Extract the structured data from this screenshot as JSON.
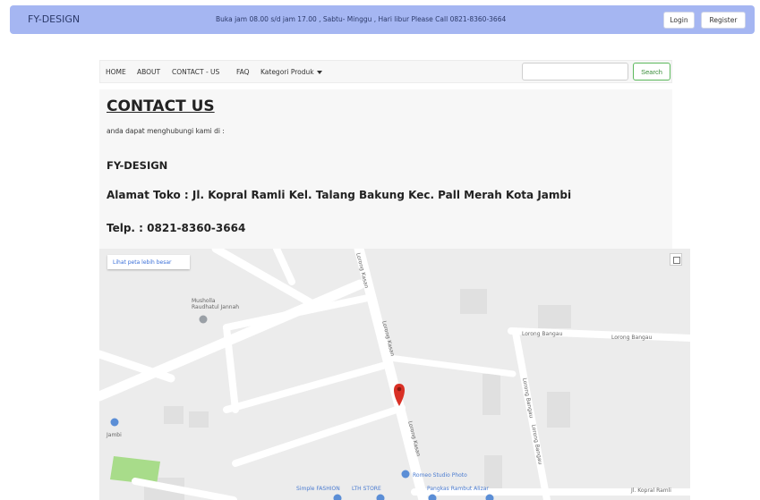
{
  "topbar": {
    "brand": "FY-DESIGN",
    "announcement": "Buka jam 08.00 s/d jam 17.00 , Sabtu- Minggu , Hari libur Please Call 0821-8360-3664",
    "login_label": "Login",
    "register_label": "Register"
  },
  "nav": {
    "items": [
      {
        "label": "HOME"
      },
      {
        "label": "ABOUT"
      },
      {
        "label": "CONTACT - US"
      },
      {
        "label": "FAQ"
      },
      {
        "label": "Kategori Produk"
      }
    ],
    "search": {
      "value": "",
      "placeholder": "",
      "button_label": "Search"
    }
  },
  "contact": {
    "title": "CONTACT US",
    "subtitle": "anda dapat menghubungi kami di :",
    "store_name": "FY-DESIGN",
    "address": "Alamat Toko : Jl. Kopral Ramli Kel. Talang Bakung Kec. Pall Merah Kota Jambi",
    "phone": "Telp. : 0821-8360-3664"
  },
  "map": {
    "larger_map_link": "Lihat peta lebih besar",
    "labels": {
      "mushola": "Musholla\nRaudhatul Jannah",
      "lorong_bangau_1": "Lorong Bangau",
      "lorong_bangau_2": "Lorong Bangau",
      "lorong_bangau_3": "Lorong Bangau",
      "lorong_bangau_4": "Lorong Bangau",
      "lorong_kasan_1": "Lorong Kasan",
      "lorong_kasan_2": "Lorong Kasan",
      "lorong_kasan_3": "Lorong Kasan",
      "jambi": "Jambi",
      "romeo": "Romeo Studio Photo",
      "simple_fashion": "Simple FASHION",
      "lth_store": "LTH STORE",
      "pangkas": "Pangkas Rambut Alizar",
      "kopral_ramli": "Jl. Kopral Ramli"
    },
    "colors": {
      "pin": "#d93025",
      "park": "#a8dc8a",
      "poi": "#5b8ed6"
    }
  }
}
